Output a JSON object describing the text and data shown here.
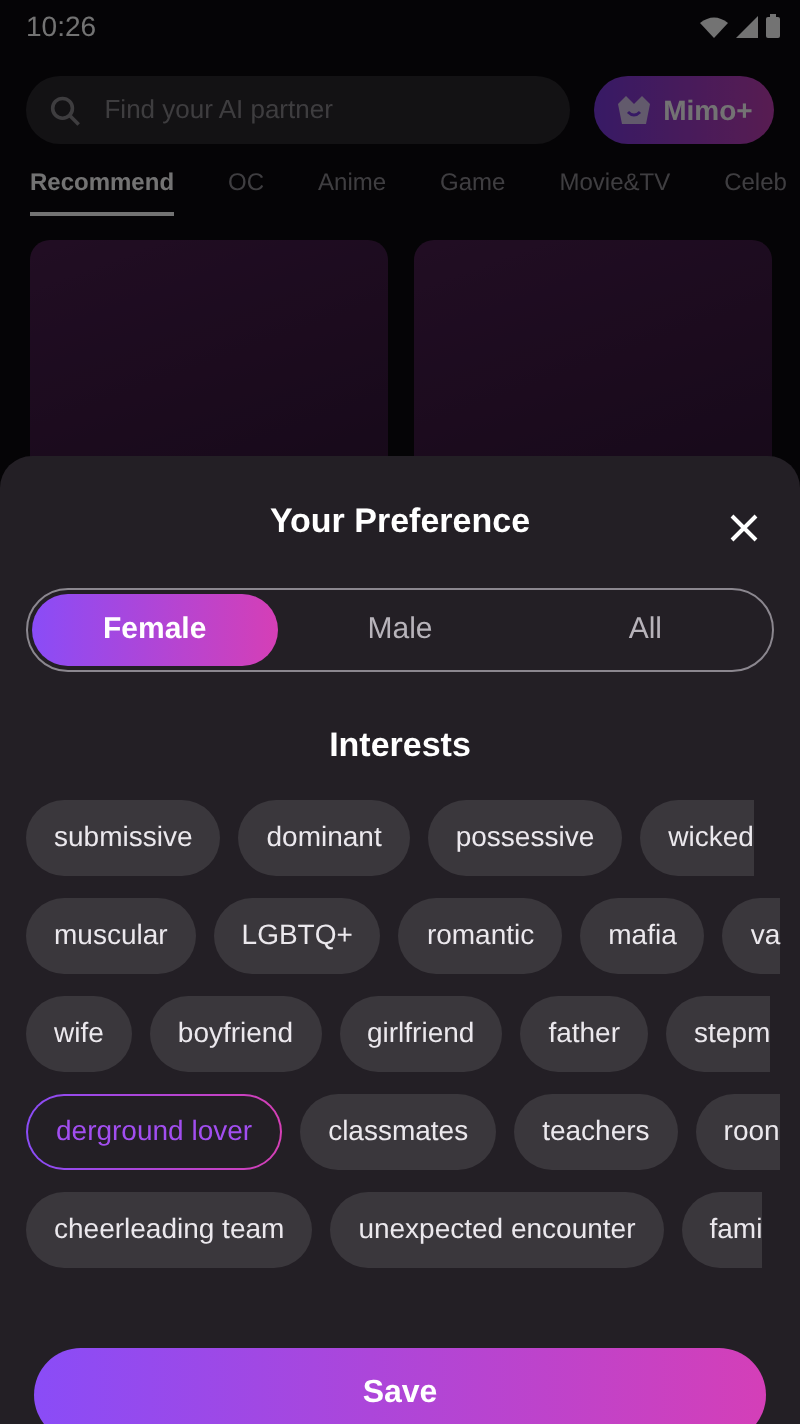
{
  "status_bar": {
    "time": "10:26"
  },
  "search": {
    "placeholder": "Find your AI partner"
  },
  "premium_button": {
    "label": "Mimo+"
  },
  "tabs": [
    {
      "label": "Recommend",
      "selected": true
    },
    {
      "label": "OC",
      "selected": false
    },
    {
      "label": "Anime",
      "selected": false
    },
    {
      "label": "Game",
      "selected": false
    },
    {
      "label": "Movie&TV",
      "selected": false
    },
    {
      "label": "Celeb",
      "selected": false
    }
  ],
  "preference_sheet": {
    "title": "Your Preference",
    "genders": [
      {
        "label": "Female",
        "selected": true
      },
      {
        "label": "Male",
        "selected": false
      },
      {
        "label": "All",
        "selected": false
      }
    ],
    "interests_title": "Interests",
    "interest_rows": [
      [
        {
          "label": "submissive",
          "selected": false
        },
        {
          "label": "dominant",
          "selected": false
        },
        {
          "label": "possessive",
          "selected": false
        },
        {
          "label": "wicked",
          "selected": false
        }
      ],
      [
        {
          "label": "muscular",
          "selected": false
        },
        {
          "label": "LGBTQ+",
          "selected": false
        },
        {
          "label": "romantic",
          "selected": false
        },
        {
          "label": "mafia",
          "selected": false
        },
        {
          "label": "va",
          "selected": false
        }
      ],
      [
        {
          "label": "wife",
          "selected": false
        },
        {
          "label": "boyfriend",
          "selected": false
        },
        {
          "label": "girlfriend",
          "selected": false
        },
        {
          "label": "father",
          "selected": false
        },
        {
          "label": "stepm",
          "selected": false
        }
      ],
      [
        {
          "label": "derground lover",
          "selected": true
        },
        {
          "label": "classmates",
          "selected": false
        },
        {
          "label": "teachers",
          "selected": false
        },
        {
          "label": "roon",
          "selected": false
        }
      ],
      [
        {
          "label": "cheerleading team",
          "selected": false
        },
        {
          "label": "unexpected encounter",
          "selected": false
        },
        {
          "label": "fami",
          "selected": false
        }
      ]
    ],
    "save_button": {
      "label": "Save"
    }
  }
}
